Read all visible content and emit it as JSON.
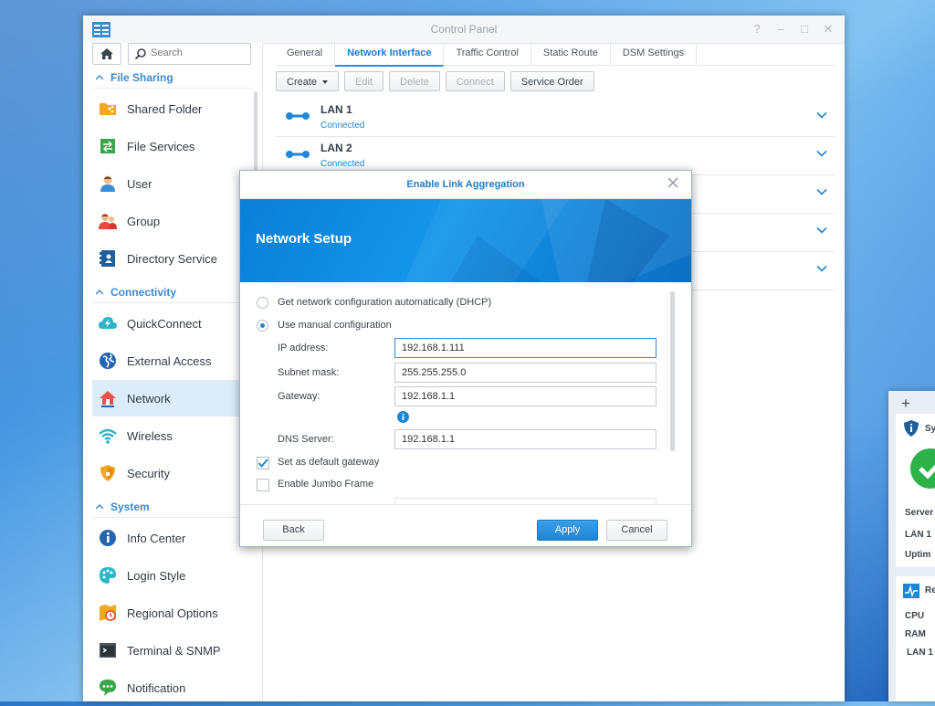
{
  "control_panel": {
    "title": "Control Panel",
    "window_controls": [
      "?",
      "–",
      "□",
      "✕"
    ]
  },
  "sidebar": {
    "search_placeholder": "Search",
    "sections": [
      {
        "label": "File Sharing",
        "items": [
          {
            "label": "Shared Folder",
            "icon": "shared-folder-icon"
          },
          {
            "label": "File Services",
            "icon": "file-services-icon"
          },
          {
            "label": "User",
            "icon": "user-icon"
          },
          {
            "label": "Group",
            "icon": "group-icon"
          },
          {
            "label": "Directory Service",
            "icon": "directory-service-icon"
          }
        ]
      },
      {
        "label": "Connectivity",
        "items": [
          {
            "label": "QuickConnect",
            "icon": "quickconnect-icon"
          },
          {
            "label": "External Access",
            "icon": "external-access-icon"
          },
          {
            "label": "Network",
            "icon": "network-icon",
            "active": true
          },
          {
            "label": "Wireless",
            "icon": "wireless-icon"
          },
          {
            "label": "Security",
            "icon": "security-icon"
          }
        ]
      },
      {
        "label": "System",
        "items": [
          {
            "label": "Info Center",
            "icon": "info-center-icon"
          },
          {
            "label": "Login Style",
            "icon": "login-style-icon"
          },
          {
            "label": "Regional Options",
            "icon": "regional-options-icon"
          },
          {
            "label": "Terminal & SNMP",
            "icon": "terminal-icon"
          },
          {
            "label": "Notification",
            "icon": "notification-icon"
          }
        ]
      }
    ]
  },
  "tabs": [
    "General",
    "Network Interface",
    "Traffic Control",
    "Static Route",
    "DSM Settings"
  ],
  "active_tab": "Network Interface",
  "toolbar": {
    "create": "Create",
    "edit": "Edit",
    "delete": "Delete",
    "connect": "Connect",
    "service_order": "Service Order"
  },
  "interfaces": [
    {
      "name": "LAN 1",
      "status": "Connected"
    },
    {
      "name": "LAN 2",
      "status": "Connected"
    }
  ],
  "dialog": {
    "title": "Enable Link Aggregation",
    "banner_title": "Network Setup",
    "option_dhcp": "Get network configuration automatically (DHCP)",
    "option_manual": "Use manual configuration",
    "selected_option": "manual",
    "ip_label": "IP address:",
    "ip_value": "192.168.1.111",
    "subnet_label": "Subnet mask:",
    "subnet_value": "255.255.255.0",
    "gateway_label": "Gateway:",
    "gateway_value": "192.168.1.1",
    "dns_label": "DNS Server:",
    "dns_value": "192.168.1.1",
    "default_gateway_label": "Set as default gateway",
    "default_gateway_checked": true,
    "jumbo_frame_label": "Enable Jumbo Frame",
    "jumbo_frame_checked": false,
    "back": "Back",
    "apply": "Apply",
    "cancel": "Cancel"
  },
  "widget": {
    "add": "+",
    "system_health_label": "Sy",
    "server_label": "Server",
    "lan1_label": "LAN 1",
    "uptime_label": "Uptim",
    "resource_monitor_label": "Re",
    "cpu_label": "CPU",
    "ram_label": "RAM",
    "lan1_res_label": "LAN 1"
  },
  "colors": {
    "accent": "#1f86d6",
    "active_nav_bg": "#dcecf9",
    "health_ok": "#2db24a"
  }
}
